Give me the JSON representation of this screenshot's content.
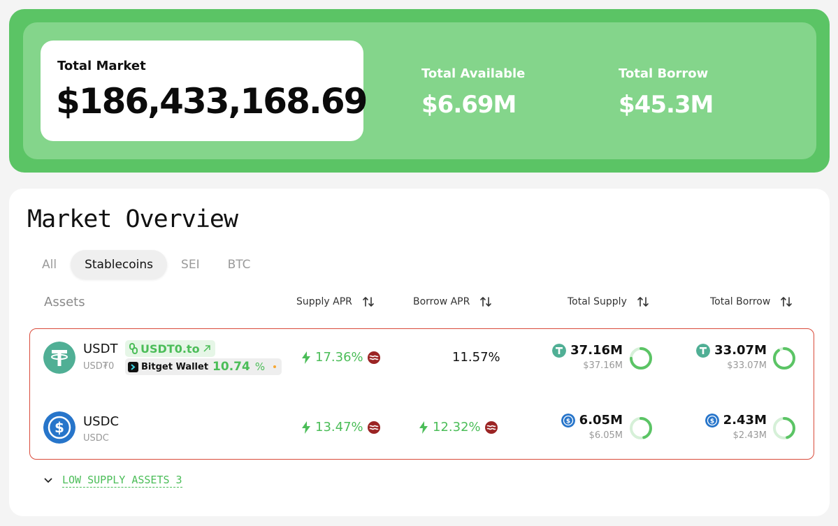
{
  "hero": {
    "total_market_label": "Total Market",
    "total_market_value": "$186,433,168.69",
    "total_available_label": "Total Available",
    "total_available_value": "$6.69M",
    "total_borrow_label": "Total Borrow",
    "total_borrow_value": "$45.3M"
  },
  "overview": {
    "title": "Market Overview",
    "tabs": [
      {
        "label": "All",
        "active": false
      },
      {
        "label": "Stablecoins",
        "active": true
      },
      {
        "label": "SEI",
        "active": false
      },
      {
        "label": "BTC",
        "active": false
      }
    ],
    "columns": {
      "assets": "Assets",
      "supply_apr": "Supply APR",
      "borrow_apr": "Borrow APR",
      "total_supply": "Total Supply",
      "total_borrow": "Total Borrow"
    },
    "rows": [
      {
        "symbol": "USDT",
        "subname": "USD₮0",
        "link_label": "USDT0.to",
        "bitget_label": "Bitget Wallet",
        "bitget_apr": "10.74",
        "bitget_unit": "%",
        "supply_apr": "17.36%",
        "borrow_apr": "11.57%",
        "total_supply": "37.16M",
        "total_supply_usd": "$37.16M",
        "total_borrow": "33.07M",
        "total_borrow_usd": "$33.07M",
        "supply_utilization": 0.75,
        "borrow_utilization": 0.9
      },
      {
        "symbol": "USDC",
        "subname": "USDC",
        "supply_apr": "13.47%",
        "borrow_apr": "12.32%",
        "total_supply": "6.05M",
        "total_supply_usd": "$6.05M",
        "total_borrow": "2.43M",
        "total_borrow_usd": "$2.43M",
        "supply_utilization": 0.45,
        "borrow_utilization": 0.45
      }
    ],
    "low_supply_label": "LOW SUPPLY ASSETS 3"
  },
  "colors": {
    "hero_outer": "#5bc465",
    "hero_inner": "#84d58b",
    "accent_green": "#4bbd58",
    "tether": "#50af95",
    "usdc": "#2775ca",
    "row_border": "#d94a3a"
  }
}
